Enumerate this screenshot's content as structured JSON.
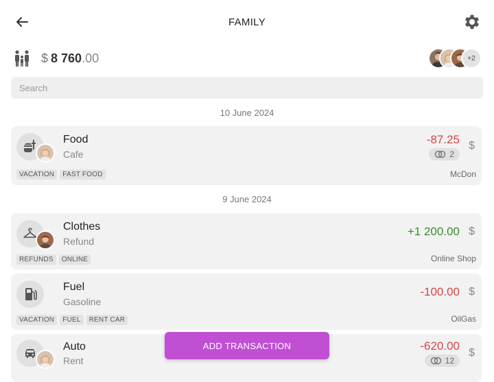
{
  "header": {
    "title": "FAMILY",
    "back_icon": "arrow-left-icon",
    "settings_icon": "gear-icon"
  },
  "balance": {
    "currency": "$",
    "integer": "8 760",
    "decimal": ".00"
  },
  "members": {
    "more": "+2"
  },
  "search": {
    "placeholder": "Search"
  },
  "groups": [
    {
      "date": "10 June 2024"
    },
    {
      "date": "9 June 2024"
    }
  ],
  "transactions": [
    {
      "title": "Food",
      "subtitle": "Cafe",
      "icon": "food-icon",
      "amount_int": "-87.",
      "amount_dec": "25",
      "currency": "$",
      "split_count": "2",
      "tags": [
        "VACATION",
        "FAST FOOD"
      ],
      "merchant": "McDon",
      "color": "#d64545"
    },
    {
      "title": "Clothes",
      "subtitle": "Refund",
      "icon": "hanger-icon",
      "amount_int": "+1 200.",
      "amount_dec": "00",
      "currency": "$",
      "tags": [
        "REFUNDS",
        "ONLINE"
      ],
      "merchant": "Online Shop",
      "color": "#3a8a2e"
    },
    {
      "title": "Fuel",
      "subtitle": "Gasoline",
      "icon": "fuel-icon",
      "amount_int": "-100.",
      "amount_dec": "00",
      "currency": "$",
      "tags": [
        "VACATION",
        "FUEL",
        "RENT CAR"
      ],
      "merchant": "OilGas",
      "color": "#d64545"
    },
    {
      "title": "Auto",
      "subtitle": "Rent",
      "icon": "car-icon",
      "amount_int": "-620.",
      "amount_dec": "00",
      "currency": "$",
      "split_count": "12",
      "tags": [],
      "merchant": "",
      "color": "#d64545"
    }
  ],
  "actions": {
    "add_transaction": "ADD TRANSACTION"
  },
  "colors": {
    "accent": "#c04fd4",
    "negative": "#d64545",
    "positive": "#3a8a2e"
  }
}
